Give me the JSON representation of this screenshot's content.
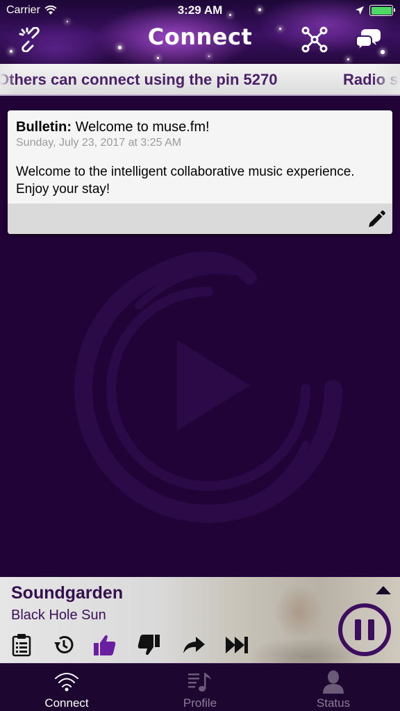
{
  "status_bar": {
    "carrier": "Carrier",
    "time": "3:29 AM",
    "battery_color": "#4cd964"
  },
  "nav": {
    "title": "Connect",
    "left_icon": "link-icon",
    "right_icons": [
      "network-icon",
      "chat-bubbles-icon"
    ]
  },
  "ticker": {
    "text": "Others can connect using the pin 5270",
    "next_text": "Radio s"
  },
  "bulletin": {
    "label": "Bulletin:",
    "title": "Welcome to muse.fm!",
    "date": "Sunday, July 23, 2017 at 3:25 AM",
    "body": "Welcome to the intelligent collaborative music experience. Enjoy your stay!",
    "edit_icon": "pencil-icon"
  },
  "now_playing": {
    "artist": "Soundgarden",
    "song": "Black Hole Sun",
    "controls": [
      "clipboard-icon",
      "history-icon",
      "thumbs-up-icon",
      "thumbs-down-icon",
      "share-arrow-icon",
      "skip-forward-icon"
    ],
    "accent_color": "#6a1fa0",
    "play_state_icon": "pause-icon"
  },
  "tabbar": {
    "tabs": [
      {
        "label": "Connect",
        "icon": "wifi-icon",
        "active": true
      },
      {
        "label": "Profile",
        "icon": "music-list-icon",
        "active": false
      },
      {
        "label": "Status",
        "icon": "user-icon",
        "active": false
      }
    ]
  },
  "colors": {
    "background": "#210338",
    "ticker_text": "#4a2168",
    "player_text": "#35104f"
  }
}
